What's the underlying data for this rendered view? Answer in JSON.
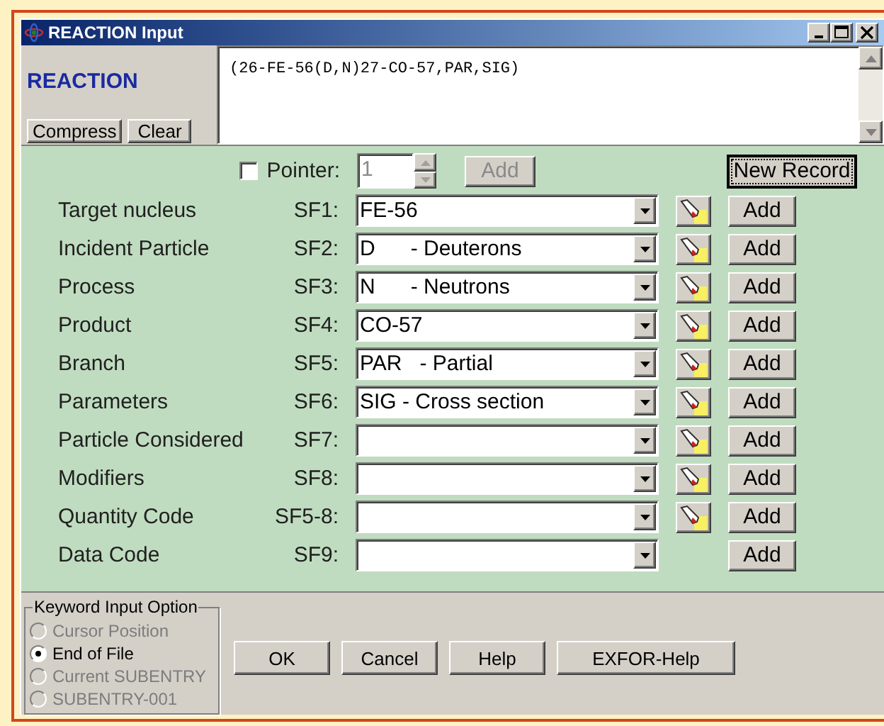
{
  "window": {
    "title": "REACTION Input"
  },
  "reaction": {
    "label": "REACTION",
    "compress_button": "Compress",
    "clear_button": "Clear",
    "text": "(26-FE-56(D,N)27-CO-57,PAR,SIG)"
  },
  "pointer": {
    "label": "Pointer:",
    "checked": false,
    "value": "1",
    "add_button": "Add",
    "disabled": true
  },
  "new_record_button": "New Record",
  "fields": [
    {
      "label": "Target nucleus",
      "code": "SF1:",
      "value": "FE-56",
      "lookup": true,
      "add_button": "Add"
    },
    {
      "label": "Incident Particle",
      "code": "SF2:",
      "value": "D      - Deuterons",
      "lookup": true,
      "add_button": "Add"
    },
    {
      "label": "Process",
      "code": "SF3:",
      "value": "N      - Neutrons",
      "lookup": true,
      "add_button": "Add"
    },
    {
      "label": "Product",
      "code": "SF4:",
      "value": "CO-57",
      "lookup": true,
      "add_button": "Add"
    },
    {
      "label": "Branch",
      "code": "SF5:",
      "value": "PAR   - Partial",
      "lookup": true,
      "add_button": "Add"
    },
    {
      "label": "Parameters",
      "code": "SF6:",
      "value": "SIG - Cross section",
      "lookup": true,
      "add_button": "Add"
    },
    {
      "label": "Particle Considered",
      "code": "SF7:",
      "lookup": true,
      "add_button": "Add"
    },
    {
      "label": "Modifiers",
      "code": "SF8:",
      "lookup": true,
      "add_button": "Add"
    },
    {
      "label": "Quantity Code",
      "code": "SF5-8:",
      "lookup": true,
      "add_button": "Add"
    },
    {
      "label": "Data Code",
      "code": "SF9:",
      "lookup": false,
      "add_button": "Add"
    }
  ],
  "keyword_input_option": {
    "title": "Keyword Input Option",
    "options": [
      {
        "label": "Cursor Position",
        "selected": false,
        "disabled": true
      },
      {
        "label": "End of File",
        "selected": true,
        "disabled": false
      },
      {
        "label": "Current SUBENTRY",
        "selected": false,
        "disabled": true
      },
      {
        "label": "SUBENTRY-001",
        "selected": false,
        "disabled": true
      }
    ]
  },
  "buttons": [
    "OK",
    "Cancel",
    "Help",
    "EXFOR-Help"
  ]
}
